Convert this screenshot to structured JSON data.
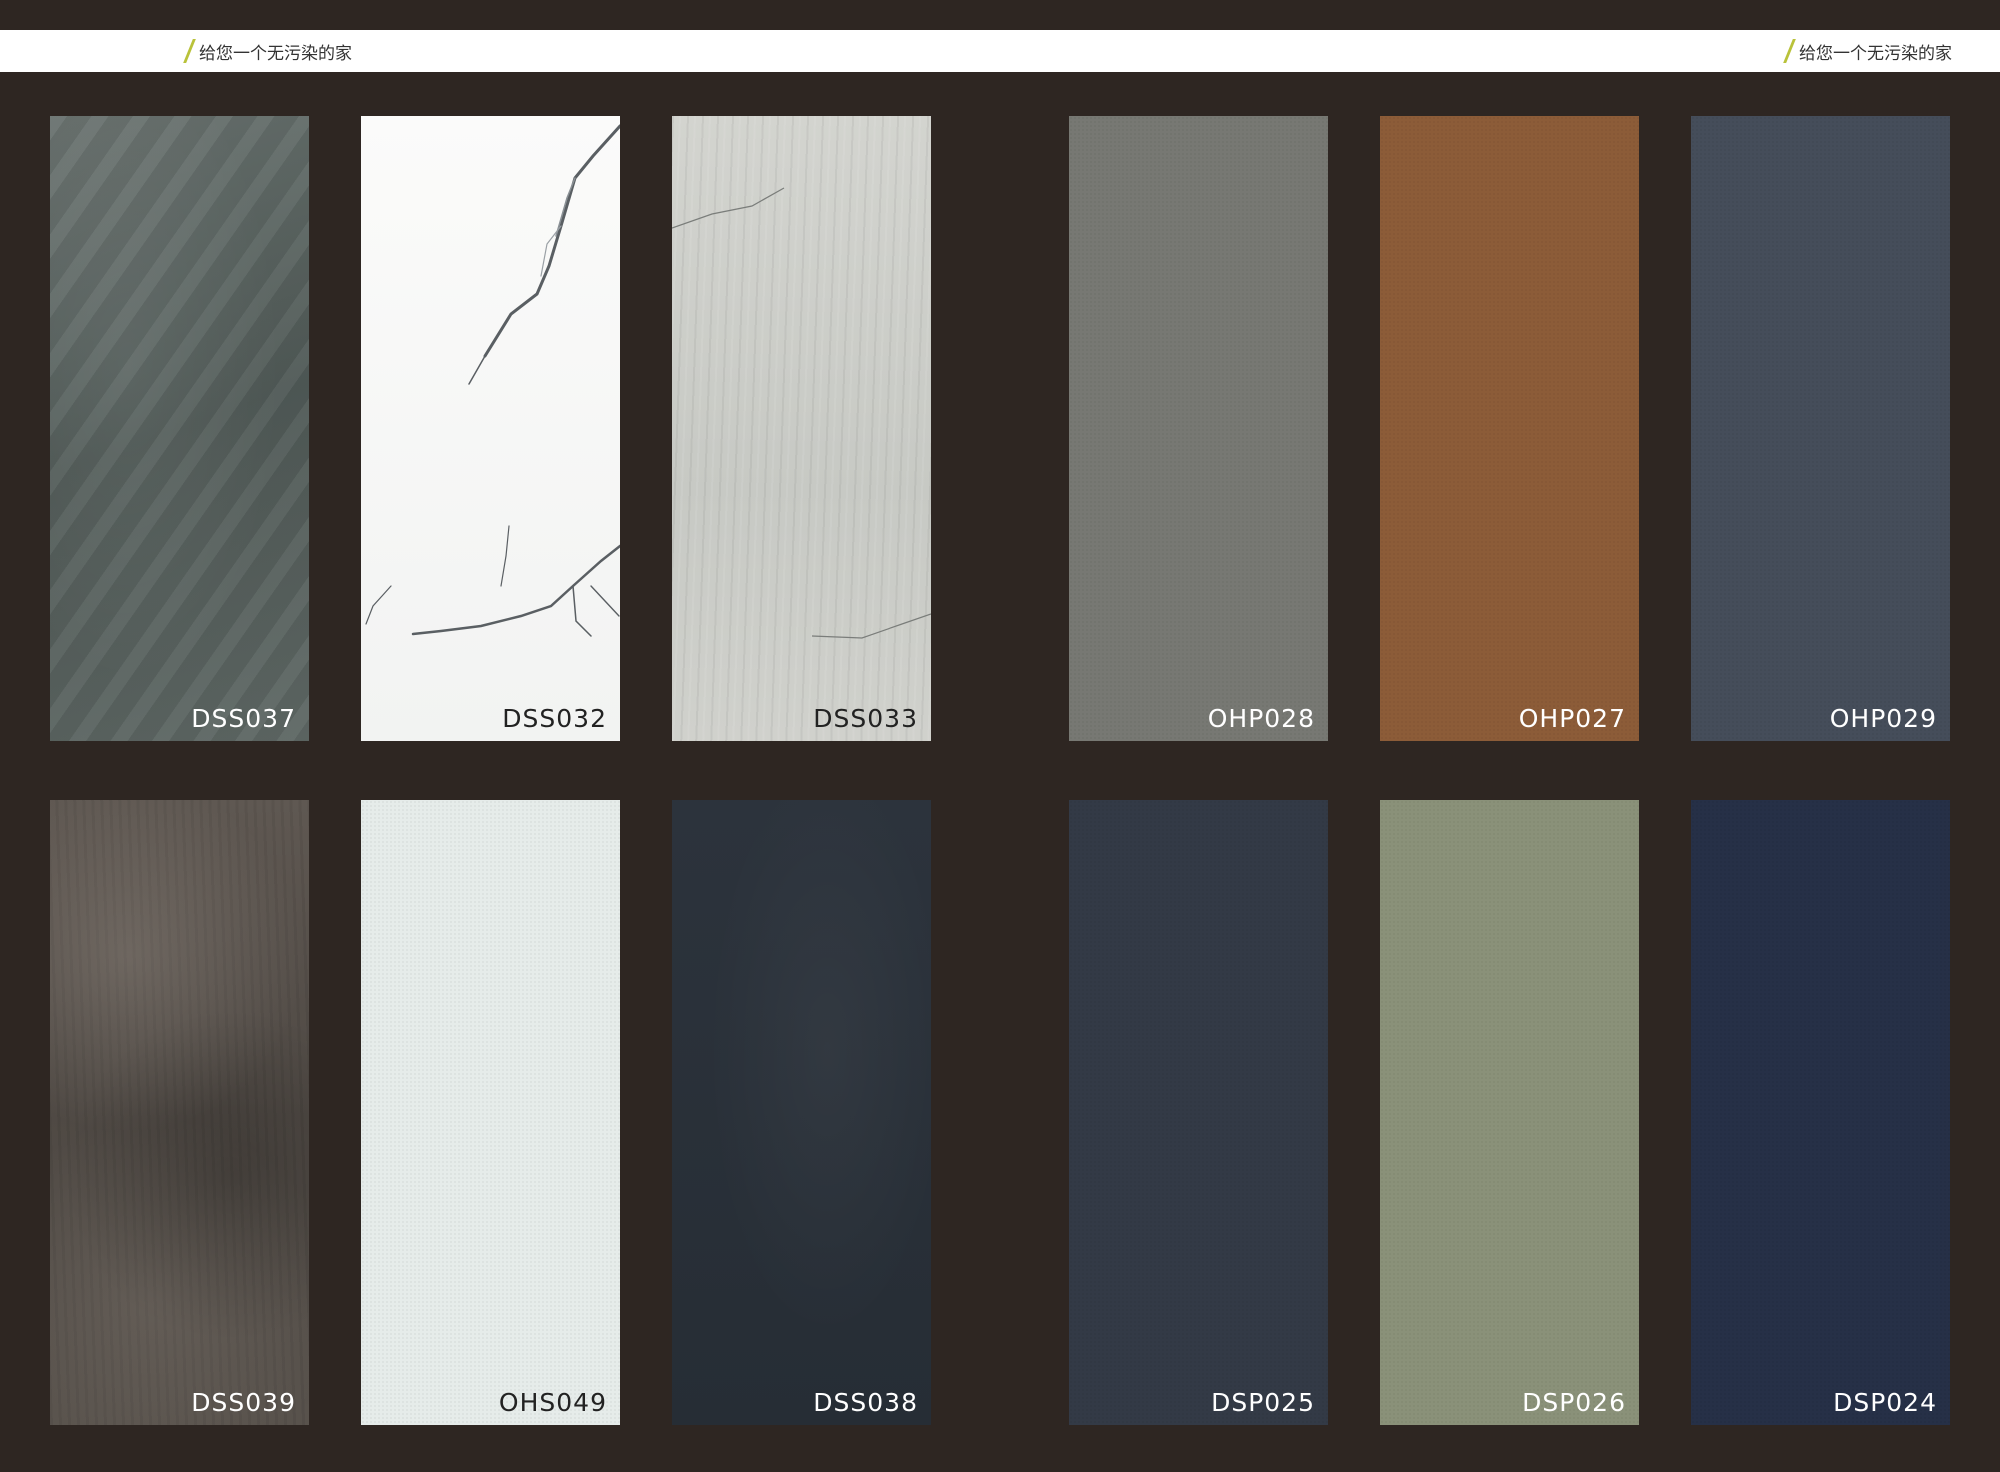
{
  "header": {
    "tagline_left": "给您一个无污染的家",
    "tagline_right": "给您一个无污染的家",
    "accent_color": "#b9c23a"
  },
  "swatches": [
    {
      "code": "DSS037",
      "color": "#5b6461",
      "label_color": "#ffffff"
    },
    {
      "code": "DSS032",
      "color": "#f7f8f7",
      "label_color": "#222222"
    },
    {
      "code": "DSS033",
      "color": "#cccdc8",
      "label_color": "#222222"
    },
    {
      "code": "OHP028",
      "color": "#777873",
      "label_color": "#ffffff"
    },
    {
      "code": "OHP027",
      "color": "#8c5c38",
      "label_color": "#ffffff"
    },
    {
      "code": "OHP029",
      "color": "#454d5a",
      "label_color": "#ffffff"
    },
    {
      "code": "DSS039",
      "color": "#544e49",
      "label_color": "#ffffff"
    },
    {
      "code": "OHS049",
      "color": "#e6ecea",
      "label_color": "#222222"
    },
    {
      "code": "DSS038",
      "color": "#293039",
      "label_color": "#ffffff"
    },
    {
      "code": "DSP025",
      "color": "#333a46",
      "label_color": "#ffffff"
    },
    {
      "code": "DSP026",
      "color": "#8a9179",
      "label_color": "#ffffff"
    },
    {
      "code": "DSP024",
      "color": "#263047",
      "label_color": "#ffffff"
    }
  ]
}
